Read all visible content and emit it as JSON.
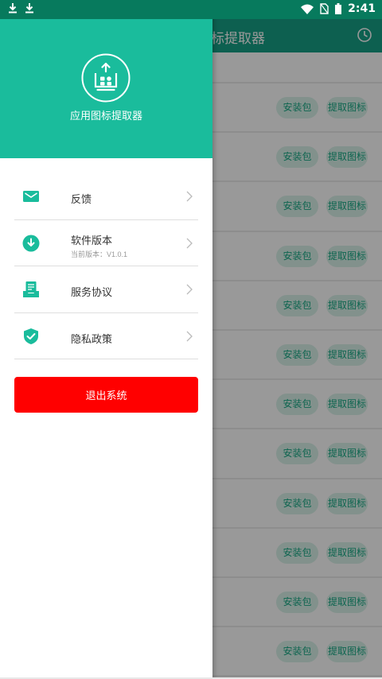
{
  "status_bar": {
    "time": "2:41"
  },
  "background": {
    "toolbar_title": "应用图标提取器",
    "row_actions": {
      "package": "安装包",
      "extract": "提取图标"
    },
    "row_count": 12
  },
  "drawer": {
    "app_name": "应用图标提取器",
    "menu": [
      {
        "label": "反馈"
      },
      {
        "label": "软件版本",
        "sub": "当前版本：V1.0.1"
      },
      {
        "label": "服务协议"
      },
      {
        "label": "隐私政策"
      }
    ],
    "logout_label": "退出系统"
  },
  "colors": {
    "accent": "#1abc9c",
    "status_bar": "#077a5d",
    "logout": "#ff0000"
  }
}
